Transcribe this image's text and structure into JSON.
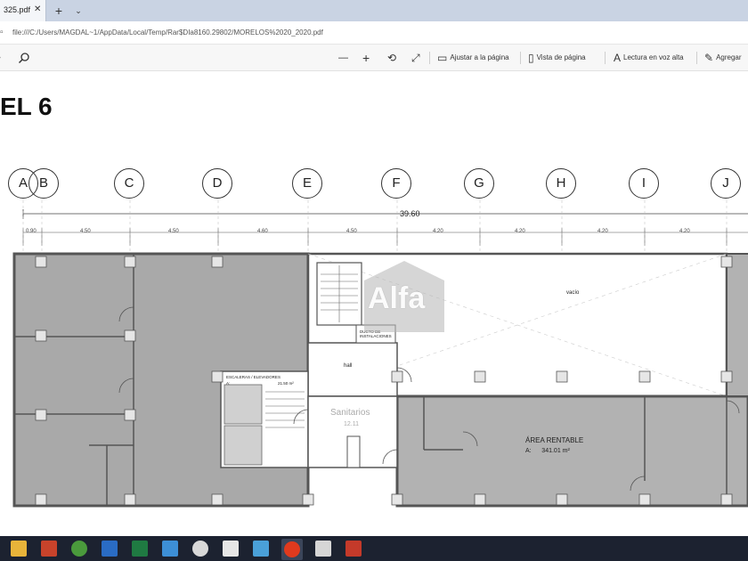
{
  "browser": {
    "tab_title": "325.pdf",
    "tab_close": "✕",
    "new_tab": "+",
    "tab_list": "⌄",
    "url": "file:///C:/Users/MAGDAL~1/AppData/Local/Temp/Rar$DIa8160.29802/MORELOS%2020_2020.pdf"
  },
  "toolbar": {
    "zoom_out": "—",
    "zoom_in": "+",
    "rotate": "⟲",
    "fullscreen": "⤢",
    "fit_page": "Ajustar a la página",
    "page_view": "Vista de página",
    "read_aloud": "Lectura en voz alta",
    "annotate": "Agregar"
  },
  "document": {
    "title": "EL 6",
    "grid_columns": [
      "A",
      "B",
      "C",
      "D",
      "E",
      "F",
      "G",
      "H",
      "I",
      "J"
    ],
    "total_dimension": "39.60",
    "dimensions": [
      "0.90",
      "4.50",
      "4.50",
      "4.60",
      "4.50",
      "4.20",
      "4.20",
      "4.20",
      "4.20"
    ],
    "labels": {
      "vacio": "vacío",
      "ducto": "DUCTO DE INSTALACIONES",
      "vestibulo": "hall",
      "escaleras": "ESCALERAS / ELEVADORES",
      "escaleras_area_prefix": "A:",
      "escaleras_area": "21.50 m²",
      "sello": "Sanitarios",
      "sello_sub": "12.11",
      "area_rentable": "ÁREA RENTABLE",
      "area_prefix": "A:",
      "area_value": "341.01 m²"
    },
    "watermark": "Alfa"
  },
  "taskbar": {
    "apps": [
      "file-explorer-icon",
      "powerpoint-icon",
      "chrome-icon",
      "outlook-icon",
      "excel-icon",
      "photos-icon",
      "cleaner-icon",
      "store-icon",
      "files-icon",
      "opera-icon",
      "media-icon",
      "acrobat-icon"
    ]
  },
  "colors": {
    "tabstrip": "#c9d3e3",
    "taskbar": "#1c2230",
    "plan_fill": "#a8a8a8",
    "plan_wall": "#555555",
    "watermark": "#bfbfbf"
  }
}
